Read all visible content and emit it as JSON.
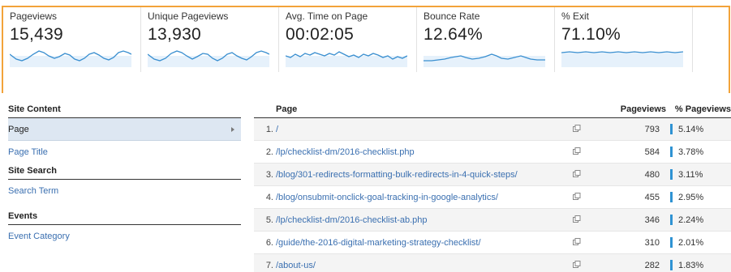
{
  "metrics": [
    {
      "label": "Pageviews",
      "value": "15,439"
    },
    {
      "label": "Unique Pageviews",
      "value": "13,930"
    },
    {
      "label": "Avg. Time on Page",
      "value": "00:02:05"
    },
    {
      "label": "Bounce Rate",
      "value": "12.64%"
    },
    {
      "label": "% Exit",
      "value": "71.10%"
    }
  ],
  "sparkline_color": "#3a8fd0",
  "left_nav": {
    "site_content": "Site Content",
    "page": "Page",
    "page_title": "Page Title",
    "site_search": "Site Search",
    "search_term": "Search Term",
    "events": "Events",
    "event_category": "Event Category"
  },
  "table": {
    "headers": {
      "page": "Page",
      "pageviews": "Pageviews",
      "pct_pageviews": "% Pageviews"
    },
    "rows": [
      {
        "idx": "1.",
        "page": "/",
        "pageviews": "793",
        "pct": "5.14%",
        "pct_value": 5.14
      },
      {
        "idx": "2.",
        "page": "/lp/checklist-dm/2016-checklist.php",
        "pageviews": "584",
        "pct": "3.78%",
        "pct_value": 3.78
      },
      {
        "idx": "3.",
        "page": "/blog/301-redirects-formatting-bulk-redirects-in-4-quick-steps/",
        "pageviews": "480",
        "pct": "3.11%",
        "pct_value": 3.11
      },
      {
        "idx": "4.",
        "page": "/blog/onsubmit-onclick-goal-tracking-in-google-analytics/",
        "pageviews": "455",
        "pct": "2.95%",
        "pct_value": 2.95
      },
      {
        "idx": "5.",
        "page": "/lp/checklist-dm/2016-checklist-ab.php",
        "pageviews": "346",
        "pct": "2.24%",
        "pct_value": 2.24
      },
      {
        "idx": "6.",
        "page": "/guide/the-2016-digital-marketing-strategy-checklist/",
        "pageviews": "310",
        "pct": "2.01%",
        "pct_value": 2.01
      },
      {
        "idx": "7.",
        "page": "/about-us/",
        "pageviews": "282",
        "pct": "1.83%",
        "pct_value": 1.83
      }
    ],
    "bar_color": "#2f93d3",
    "link_color": "#3a6fb0"
  }
}
